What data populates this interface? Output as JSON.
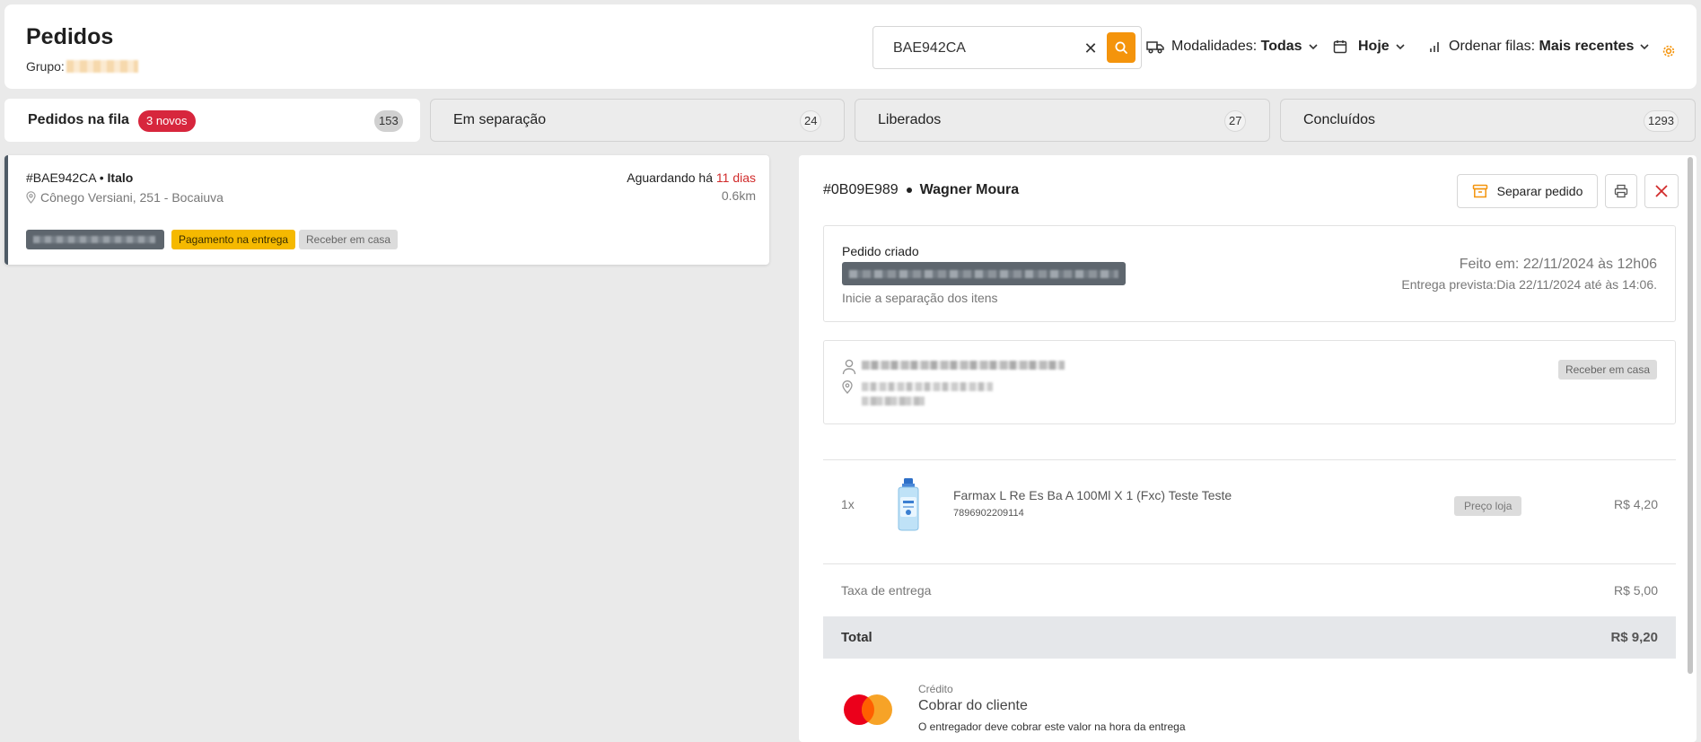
{
  "header": {
    "title": "Pedidos",
    "group_label": "Grupo:",
    "search_value": "BAE942CA",
    "clear_symbol": "✕",
    "modalidades_label": "Modalidades:",
    "modalidades_value": "Todas",
    "date_value": "Hoje",
    "ordenar_label": "Ordenar filas:",
    "ordenar_value": "Mais recentes"
  },
  "tabs": [
    {
      "label": "Pedidos na fila",
      "count": "153",
      "badge": "3 novos"
    },
    {
      "label": "Em separação",
      "count": "24"
    },
    {
      "label": "Liberados",
      "count": "27"
    },
    {
      "label": "Concluídos",
      "count": "1293"
    }
  ],
  "order_card": {
    "id": "#BAE942CA",
    "customer": "Italo",
    "address": "Cônego Versiani, 251 - Bocaiuva",
    "waiting_prefix": "Aguardando há",
    "waiting_value": "11 dias",
    "distance": "0.6km",
    "tag_payment": "Pagamento na entrega",
    "tag_delivery": "Receber em casa"
  },
  "detail": {
    "order_id": "#0B09E989",
    "customer": "Wagner Moura",
    "separate_button": "Separar pedido",
    "status_label": "Pedido criado",
    "status_sub": "Inicie a separação dos itens",
    "feito_em": "Feito em: 22/11/2024 às 12h06",
    "entrega_prevista": "Entrega prevista:Dia 22/11/2024 até às 14:06.",
    "delivery_tag": "Receber em casa",
    "item": {
      "qty": "1x",
      "name": "Farmax L Re Es Ba A 100Ml X 1 (Fxc) Teste Teste",
      "ean": "7896902209114",
      "tag": "Preço loja",
      "price": "R$ 4,20"
    },
    "fee_label": "Taxa de entrega",
    "fee_value": "R$ 5,00",
    "total_label": "Total",
    "total_value": "R$ 9,20",
    "payment": {
      "type": "Crédito",
      "title": "Cobrar do cliente",
      "note": "O entregador deve cobrar este valor na hora da entrega"
    }
  },
  "colors": {
    "accent_orange": "#f4940c",
    "badge_red": "#d7263d",
    "tag_yellow": "#f5b900",
    "waiting_red": "#d12b2b"
  }
}
